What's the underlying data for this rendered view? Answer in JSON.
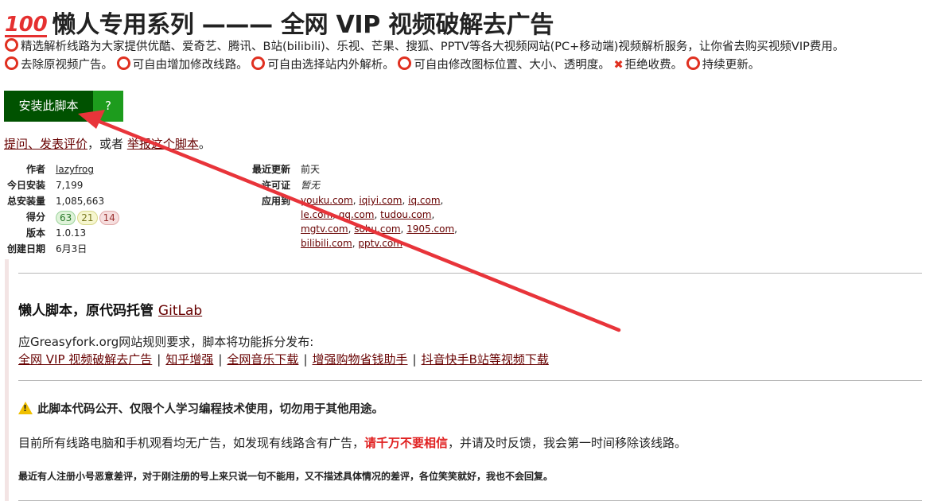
{
  "header": {
    "emoji": "100",
    "title": "懒人专用系列 ——— 全网 VIP 视频破解去广告"
  },
  "description": {
    "line1": "精选解析线路为大家提供优酷、爱奇艺、腾讯、B站(bilibili)、乐视、芒果、搜狐、PPTV等各大视频网站(PC+移动端)视频解析服务，让你省去购买视频VIP费用。",
    "features": [
      "去除原视频广告。",
      "可自由增加修改线路。",
      "可自由选择站内外解析。",
      "可自由修改图标位置、大小、透明度。"
    ],
    "no_fee": "拒绝收费。",
    "updating": "持续更新。"
  },
  "install": {
    "label": "安装此脚本",
    "help": "?"
  },
  "feedback": {
    "ask_link": "提问、发表评价",
    "or_text": "，或者",
    "report_link": "举报这个脚本",
    "end": "。"
  },
  "meta_left": {
    "author_label": "作者",
    "author": "lazyfrog",
    "daily_label": "今日安装",
    "daily": "7,199",
    "total_label": "总安装量",
    "total": "1,085,663",
    "score_label": "得分",
    "score_good": "63",
    "score_ok": "21",
    "score_bad": "14",
    "version_label": "版本",
    "version": "1.0.13",
    "created_label": "创建日期",
    "created": "6月3日"
  },
  "meta_right": {
    "updated_label": "最近更新",
    "updated": "前天",
    "license_label": "许可证",
    "license": "暂无",
    "applies_label": "应用到",
    "sites": [
      "youku.com",
      "iqiyi.com",
      "iq.com",
      "le.com",
      "qq.com",
      "tudou.com",
      "mgtv.com",
      "sohu.com",
      "1905.com",
      "bilibili.com",
      "pptv.com"
    ]
  },
  "content": {
    "heading": "懒人脚本，原代码托管",
    "gitlab": "GitLab",
    "split_note": "应Greasyfork.org网站规则要求，脚本将功能拆分发布:",
    "links": [
      "全网 VIP 视频破解去广告",
      "知乎增强",
      "全网音乐下载",
      "增强购物省钱助手",
      "抖音快手B站等视频下载"
    ],
    "warning": "此脚本代码公开、仅限个人学习编程技术使用，切勿用于其他用途。",
    "notice_pre": "目前所有线路电脑和手机观看均无广告，如发现有线路含有广告，",
    "notice_red": "请千万不要相信",
    "notice_post": "，并请及时反馈，我会第一时间移除该线路。",
    "small_note": "最近有人注册小号恶意差评，对于刚注册的号上来只说一句不能用，又不描述具体情况的差评，各位笑笑就好，我也不会回复。"
  },
  "colors": {
    "install": "#005200",
    "help": "#1d9c1d",
    "link": "#670000",
    "annotation_arrow": "#e8343a"
  }
}
